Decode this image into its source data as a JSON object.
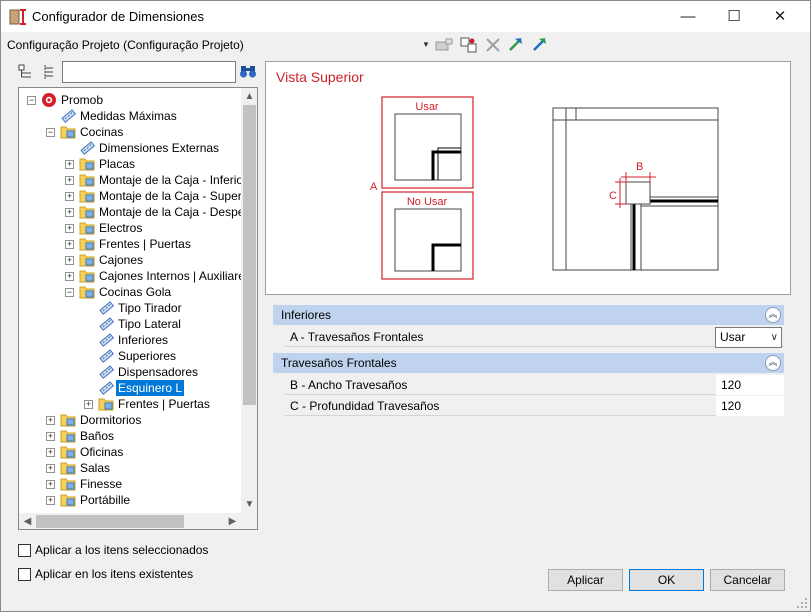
{
  "window": {
    "title": "Configurador de Dimensiones",
    "minimize": "—",
    "maximize": "☐",
    "close": "✕"
  },
  "config": {
    "label": "Configuração Projeto (Configuração Projeto)",
    "dropdown_glyph": "▼"
  },
  "toolbar_icons": [
    "insert-icon",
    "move-icon",
    "delete-icon",
    "import-icon",
    "export-icon"
  ],
  "search": {
    "value": "",
    "placeholder": ""
  },
  "tree": {
    "items": [
      {
        "label": "Promob",
        "level": 0,
        "icon": "promob-logo-icon",
        "expander": "−"
      },
      {
        "label": "Medidas Máximas",
        "level": 1,
        "icon": "ruler-icon"
      },
      {
        "label": "Cocinas",
        "level": 1,
        "icon": "folder-icon",
        "expander": "−"
      },
      {
        "label": "Dimensiones Externas",
        "level": 2,
        "icon": "ruler-icon"
      },
      {
        "label": "Placas",
        "level": 2,
        "icon": "folder-icon",
        "expander": "+"
      },
      {
        "label": "Montaje de la Caja - Inferior",
        "level": 2,
        "icon": "folder-icon",
        "expander": "+"
      },
      {
        "label": "Montaje de la Caja - Superior",
        "level": 2,
        "icon": "folder-icon",
        "expander": "+"
      },
      {
        "label": "Montaje de la Caja - Despensa",
        "level": 2,
        "icon": "folder-icon",
        "expander": "+"
      },
      {
        "label": "Electros",
        "level": 2,
        "icon": "folder-icon",
        "expander": "+"
      },
      {
        "label": "Frentes | Puertas",
        "level": 2,
        "icon": "folder-icon",
        "expander": "+"
      },
      {
        "label": "Cajones",
        "level": 2,
        "icon": "folder-icon",
        "expander": "+"
      },
      {
        "label": "Cajones Internos | Auxiliares",
        "level": 2,
        "icon": "folder-icon",
        "expander": "+"
      },
      {
        "label": "Cocinas Gola",
        "level": 2,
        "icon": "folder-icon",
        "expander": "−"
      },
      {
        "label": "Tipo Tirador",
        "level": 3,
        "icon": "ruler-icon"
      },
      {
        "label": "Tipo Lateral",
        "level": 3,
        "icon": "ruler-icon"
      },
      {
        "label": "Inferiores",
        "level": 3,
        "icon": "ruler-icon"
      },
      {
        "label": "Superiores",
        "level": 3,
        "icon": "ruler-icon"
      },
      {
        "label": "Dispensadores",
        "level": 3,
        "icon": "ruler-icon"
      },
      {
        "label": "Esquinero L",
        "level": 3,
        "icon": "ruler-icon",
        "selected": true
      },
      {
        "label": "Frentes | Puertas",
        "level": 3,
        "icon": "folder-icon",
        "expander": "+"
      },
      {
        "label": "Dormitorios",
        "level": 1,
        "icon": "folder-icon",
        "expander": "+"
      },
      {
        "label": "Baños",
        "level": 1,
        "icon": "folder-icon",
        "expander": "+"
      },
      {
        "label": "Oficinas",
        "level": 1,
        "icon": "folder-icon",
        "expander": "+"
      },
      {
        "label": "Salas",
        "level": 1,
        "icon": "folder-icon",
        "expander": "+"
      },
      {
        "label": "Finesse",
        "level": 1,
        "icon": "folder-icon",
        "expander": "+"
      },
      {
        "label": "Portábille",
        "level": 1,
        "icon": "folder-icon",
        "expander": "+"
      }
    ]
  },
  "preview": {
    "title": "Vista Superior",
    "use_label": "Usar",
    "no_use_label": "No Usar",
    "marker_a": "A",
    "marker_b": "B",
    "marker_c": "C"
  },
  "properties": {
    "categories": [
      {
        "title": "Inferiores",
        "collapse_glyph": "︽",
        "rows": [
          {
            "name": "A - Travesaños Frontales",
            "value": "Usar",
            "type": "select",
            "arrow": "∨"
          }
        ]
      },
      {
        "title": "Travesaños Frontales",
        "collapse_glyph": "︽",
        "rows": [
          {
            "name": "B - Ancho Travesaños",
            "value": "120",
            "type": "text"
          },
          {
            "name": "C - Profundidad Travesaños",
            "value": "120",
            "type": "text"
          }
        ]
      }
    ]
  },
  "options": {
    "apply_selected": "Aplicar a los itens seleccionados",
    "apply_existing": "Aplicar en los itens existentes"
  },
  "buttons": {
    "apply": "Aplicar",
    "ok": "OK",
    "cancel": "Cancelar"
  },
  "colors": {
    "accent_red": "#d0212b",
    "selection": "#0078d7",
    "category_bg": "#c0d3ee"
  }
}
